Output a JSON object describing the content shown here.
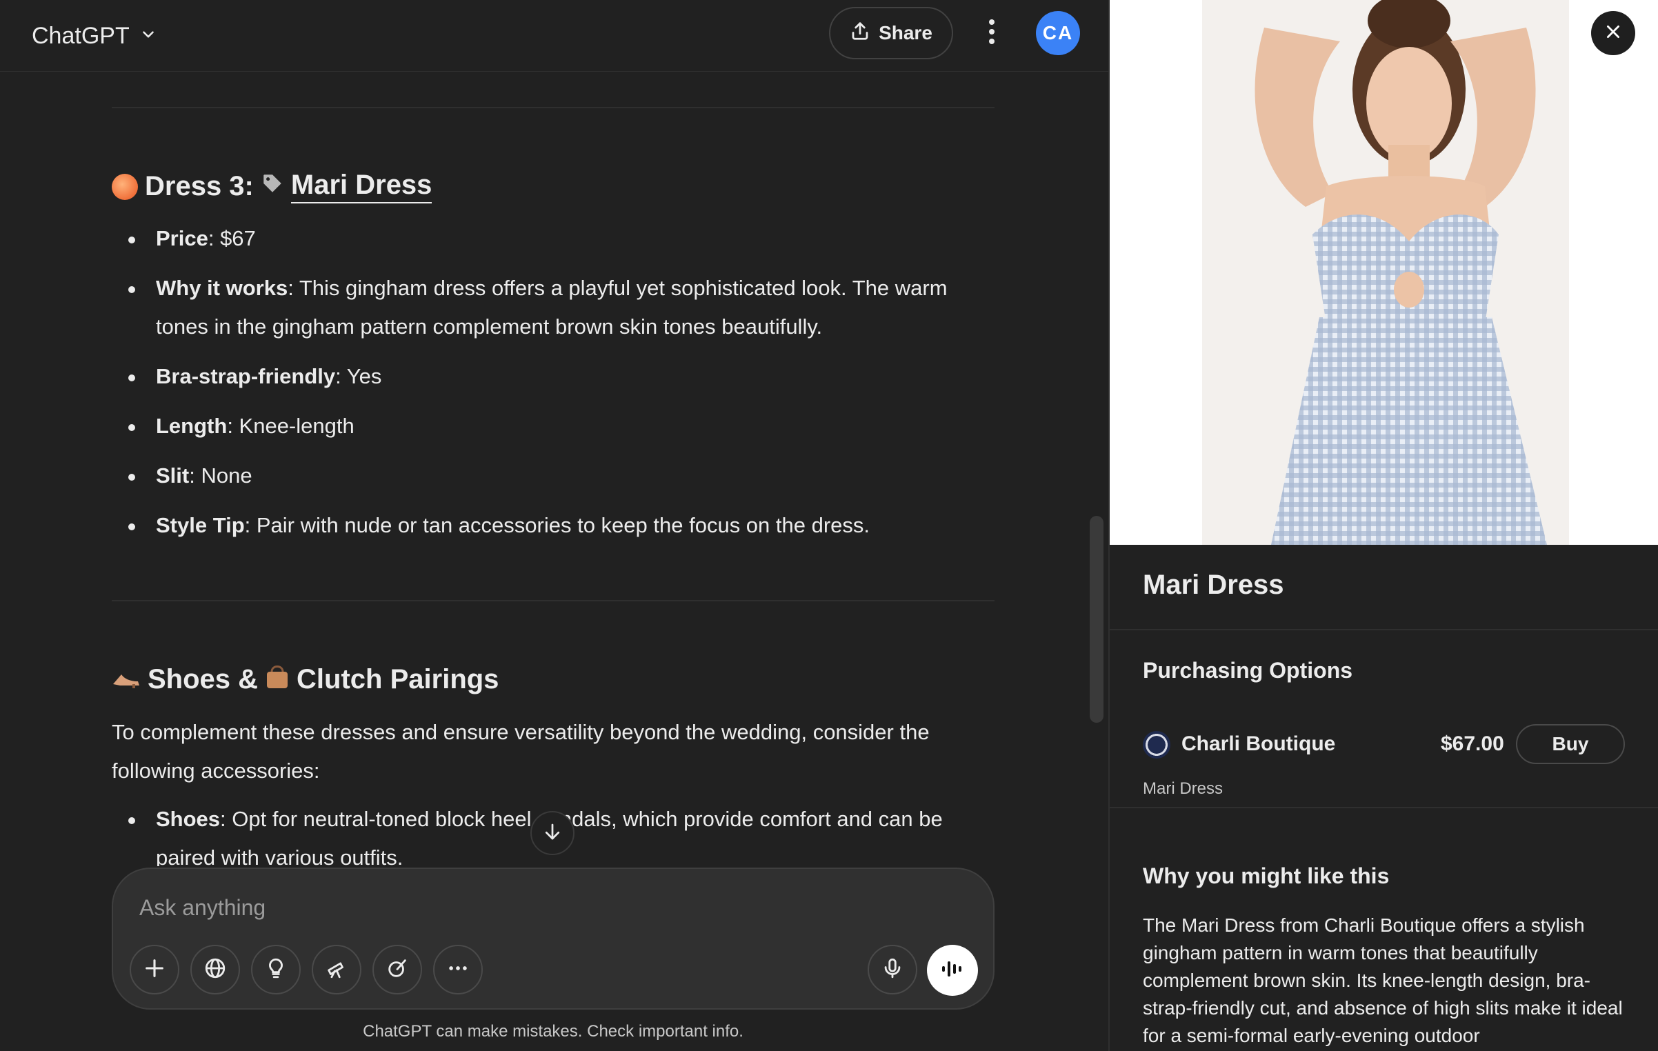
{
  "header": {
    "app_title": "ChatGPT",
    "share_label": "Share",
    "avatar_initials": "CA"
  },
  "dress3": {
    "prefix": "Dress 3:",
    "name": "Mari Dress",
    "bullets": [
      {
        "label": "Price",
        "text": ": $67"
      },
      {
        "label": "Why it works",
        "text": ": This gingham dress offers a playful yet sophisticated look. The warm tones in the gingham pattern complement brown skin tones beautifully."
      },
      {
        "label": "Bra-strap-friendly",
        "text": ": Yes"
      },
      {
        "label": "Length",
        "text": ": Knee-length"
      },
      {
        "label": "Slit",
        "text": ": None"
      },
      {
        "label": "Style Tip",
        "text": ": Pair with nude or tan accessories to keep the focus on the dress."
      }
    ]
  },
  "pairings": {
    "part1": "Shoes &",
    "part2": "Clutch Pairings",
    "intro": "To complement these dresses and ensure versatility beyond the wedding, consider the following accessories:",
    "bullets": [
      {
        "label": "Shoes",
        "text": ": Opt for neutral-toned block heel sandals, which provide comfort and can be paired with various outfits."
      }
    ]
  },
  "composer": {
    "placeholder": "Ask anything"
  },
  "footer": {
    "disclaimer": "ChatGPT can make mistakes. Check important info."
  },
  "panel": {
    "title": "Mari Dress",
    "purchasing_heading": "Purchasing Options",
    "merchant": {
      "name": "Charli Boutique",
      "price": "$67.00",
      "buy_label": "Buy",
      "product_name": "Mari Dress"
    },
    "why_heading": "Why you might like this",
    "why_text": "The Mari Dress from Charli Boutique offers a stylish gingham pattern in warm tones that beautifully complement brown skin. Its knee-length design, bra-strap-friendly cut, and absence of high slits make it ideal for a semi-formal early-evening outdoor"
  },
  "icons": [
    "chevron-down-icon",
    "share-icon",
    "more-vertical-icon",
    "peach-emoji-icon",
    "tag-icon",
    "heel-emoji-icon",
    "handbag-emoji-icon",
    "arrow-down-icon",
    "plus-icon",
    "globe-icon",
    "lightbulb-icon",
    "telescope-icon",
    "paintbrush-icon",
    "more-horizontal-icon",
    "microphone-icon",
    "voice-waveform-icon",
    "close-icon"
  ],
  "colors": {
    "background": "#212121",
    "composer": "#303030",
    "avatar": "#3b82f6",
    "text": "#ececec"
  }
}
